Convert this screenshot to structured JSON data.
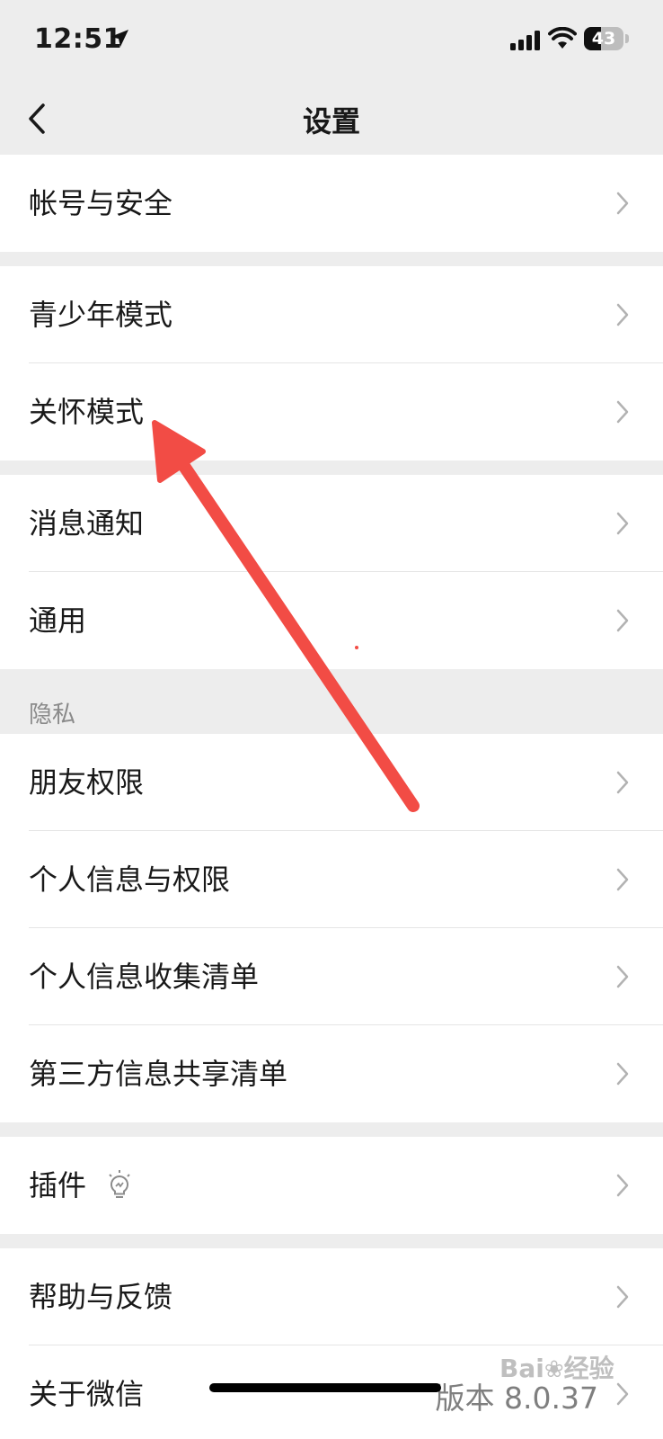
{
  "status": {
    "time": "12:51",
    "battery": "43",
    "battery_level": 0.43
  },
  "nav": {
    "title": "设置"
  },
  "groups": {
    "account": [
      "帐号与安全"
    ],
    "modes": [
      "青少年模式",
      "关怀模式"
    ],
    "general": [
      "消息通知",
      "通用"
    ],
    "privacy_header": "隐私",
    "privacy": [
      "朋友权限",
      "个人信息与权限",
      "个人信息收集清单",
      "第三方信息共享清单"
    ],
    "plugins": [
      "插件"
    ],
    "help": [
      "帮助与反馈",
      "关于微信"
    ],
    "version": "版本 8.0.37"
  },
  "watermark": {
    "text": "Bai",
    "text2": "经验"
  },
  "colors": {
    "background": "#ededed",
    "arrow": "#f24c45"
  }
}
